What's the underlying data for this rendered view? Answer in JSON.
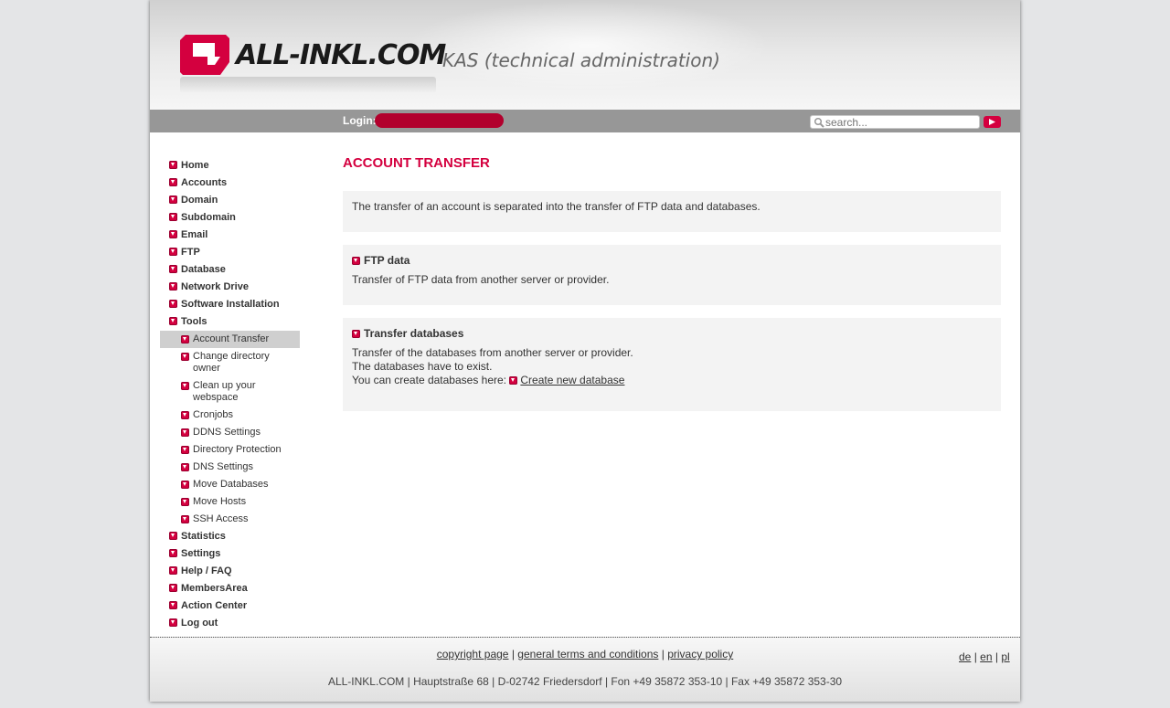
{
  "brand": {
    "logo_text": "ALL-INKL.COM",
    "subtitle": "KAS (technical administration)",
    "accent_color": "#d4003f"
  },
  "loginbar": {
    "login_label": "Login:",
    "login_value": "",
    "search_placeholder": "search...",
    "search_icon": "magnifier-icon",
    "search_button_icon": "arrow-right-icon"
  },
  "sidebar": {
    "items": [
      {
        "label": "Home"
      },
      {
        "label": "Accounts"
      },
      {
        "label": "Domain"
      },
      {
        "label": "Subdomain"
      },
      {
        "label": "Email"
      },
      {
        "label": "FTP"
      },
      {
        "label": "Database"
      },
      {
        "label": "Network Drive"
      },
      {
        "label": "Software Installation"
      },
      {
        "label": "Tools"
      }
    ],
    "tools_sub": [
      {
        "label": "Account Transfer",
        "active": true
      },
      {
        "label": "Change directory owner"
      },
      {
        "label": "Clean up your webspace"
      },
      {
        "label": "Cronjobs"
      },
      {
        "label": "DDNS Settings"
      },
      {
        "label": "Directory Protection"
      },
      {
        "label": "DNS Settings"
      },
      {
        "label": "Move Databases"
      },
      {
        "label": "Move Hosts"
      },
      {
        "label": "SSH Access"
      }
    ],
    "items_after": [
      {
        "label": "Statistics"
      },
      {
        "label": "Settings"
      },
      {
        "label": "Help / FAQ"
      },
      {
        "label": "MembersArea"
      },
      {
        "label": "Action Center"
      },
      {
        "label": "Log out"
      }
    ]
  },
  "main": {
    "title": "ACCOUNT TRANSFER",
    "intro": "The transfer of an account is separated into the transfer of FTP data and databases.",
    "ftp": {
      "heading": "FTP data",
      "text": "Transfer of FTP data from another server or provider."
    },
    "db": {
      "heading": "Transfer databases",
      "line1": "Transfer of the databases from another server or provider.",
      "line2": "The databases have to exist.",
      "line3": "You can create databases here:",
      "link": "Create new database"
    }
  },
  "footer": {
    "copyright": "copyright page",
    "terms": "general terms and conditions",
    "privacy": "privacy policy",
    "sep": "|",
    "lang_de": "de",
    "lang_en": "en",
    "lang_pl": "pl",
    "address": "ALL-INKL.COM | Hauptstraße 68 | D-02742 Friedersdorf | Fon +49 35872 353-10 | Fax +49 35872 353-30"
  }
}
